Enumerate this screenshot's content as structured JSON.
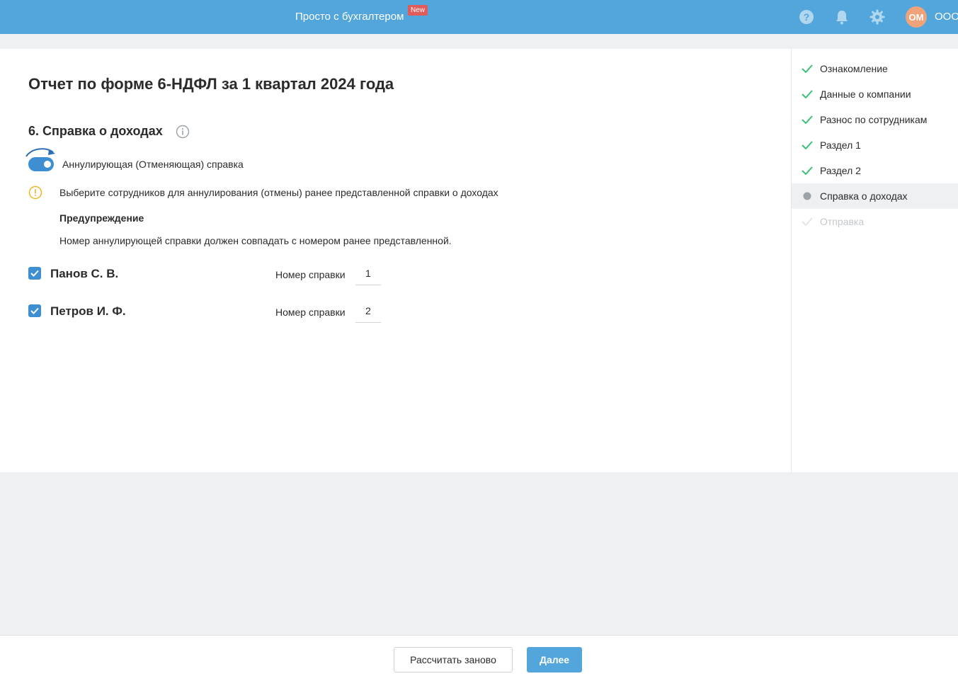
{
  "header": {
    "promo_label": "Просто с бухгалтером",
    "new_badge": "New",
    "avatar_initials": "ОМ",
    "org_name": "ООО",
    "icons": [
      "help-icon",
      "bell-icon",
      "gear-icon"
    ]
  },
  "main": {
    "title": "Отчет по форме 6-НДФЛ за 1 квартал 2024 года",
    "section_title": "6. Справка о доходах",
    "toggle_label": "Аннулирующая (Отменяющая) справка",
    "toggle_on": true,
    "info_text": "Выберите сотрудников для аннулирования (отмены) ранее представленной справки о доходах",
    "warning_heading": "Предупреждение",
    "warning_body": "Номер аннулирующей справки должен совпадать с номером ранее представленной.",
    "employees": [
      {
        "name": "Панов С. В.",
        "checked": true,
        "number_label": "Номер справки",
        "number": "1"
      },
      {
        "name": "Петров И. Ф.",
        "checked": true,
        "number_label": "Номер справки",
        "number": "2"
      }
    ]
  },
  "sidebar": {
    "steps": [
      {
        "label": "Ознакомление",
        "state": "done"
      },
      {
        "label": "Данные о компании",
        "state": "done"
      },
      {
        "label": "Разнос по сотрудникам",
        "state": "done"
      },
      {
        "label": "Раздел 1",
        "state": "done"
      },
      {
        "label": "Раздел 2",
        "state": "done"
      },
      {
        "label": "Справка о доходах",
        "state": "current"
      },
      {
        "label": "Отправка",
        "state": "disabled"
      }
    ]
  },
  "footer": {
    "recalc_label": "Рассчитать заново",
    "next_label": "Далее"
  },
  "colors": {
    "header_bg": "#52a6dc",
    "accent": "#3d8fd1",
    "check_green": "#3bbf7a",
    "warning": "#f0b429",
    "badge_red": "#e25b5b",
    "avatar_bg": "#f0a27a"
  }
}
